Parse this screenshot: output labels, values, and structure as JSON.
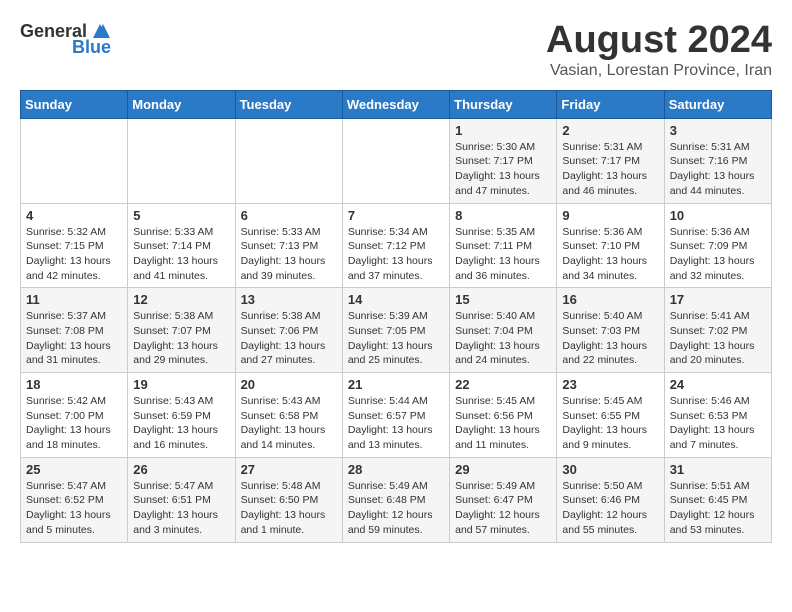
{
  "header": {
    "logo_general": "General",
    "logo_blue": "Blue",
    "main_title": "August 2024",
    "subtitle": "Vasian, Lorestan Province, Iran"
  },
  "calendar": {
    "days_of_week": [
      "Sunday",
      "Monday",
      "Tuesday",
      "Wednesday",
      "Thursday",
      "Friday",
      "Saturday"
    ],
    "weeks": [
      [
        {
          "day": "",
          "info": ""
        },
        {
          "day": "",
          "info": ""
        },
        {
          "day": "",
          "info": ""
        },
        {
          "day": "",
          "info": ""
        },
        {
          "day": "1",
          "info": "Sunrise: 5:30 AM\nSunset: 7:17 PM\nDaylight: 13 hours\nand 47 minutes."
        },
        {
          "day": "2",
          "info": "Sunrise: 5:31 AM\nSunset: 7:17 PM\nDaylight: 13 hours\nand 46 minutes."
        },
        {
          "day": "3",
          "info": "Sunrise: 5:31 AM\nSunset: 7:16 PM\nDaylight: 13 hours\nand 44 minutes."
        }
      ],
      [
        {
          "day": "4",
          "info": "Sunrise: 5:32 AM\nSunset: 7:15 PM\nDaylight: 13 hours\nand 42 minutes."
        },
        {
          "day": "5",
          "info": "Sunrise: 5:33 AM\nSunset: 7:14 PM\nDaylight: 13 hours\nand 41 minutes."
        },
        {
          "day": "6",
          "info": "Sunrise: 5:33 AM\nSunset: 7:13 PM\nDaylight: 13 hours\nand 39 minutes."
        },
        {
          "day": "7",
          "info": "Sunrise: 5:34 AM\nSunset: 7:12 PM\nDaylight: 13 hours\nand 37 minutes."
        },
        {
          "day": "8",
          "info": "Sunrise: 5:35 AM\nSunset: 7:11 PM\nDaylight: 13 hours\nand 36 minutes."
        },
        {
          "day": "9",
          "info": "Sunrise: 5:36 AM\nSunset: 7:10 PM\nDaylight: 13 hours\nand 34 minutes."
        },
        {
          "day": "10",
          "info": "Sunrise: 5:36 AM\nSunset: 7:09 PM\nDaylight: 13 hours\nand 32 minutes."
        }
      ],
      [
        {
          "day": "11",
          "info": "Sunrise: 5:37 AM\nSunset: 7:08 PM\nDaylight: 13 hours\nand 31 minutes."
        },
        {
          "day": "12",
          "info": "Sunrise: 5:38 AM\nSunset: 7:07 PM\nDaylight: 13 hours\nand 29 minutes."
        },
        {
          "day": "13",
          "info": "Sunrise: 5:38 AM\nSunset: 7:06 PM\nDaylight: 13 hours\nand 27 minutes."
        },
        {
          "day": "14",
          "info": "Sunrise: 5:39 AM\nSunset: 7:05 PM\nDaylight: 13 hours\nand 25 minutes."
        },
        {
          "day": "15",
          "info": "Sunrise: 5:40 AM\nSunset: 7:04 PM\nDaylight: 13 hours\nand 24 minutes."
        },
        {
          "day": "16",
          "info": "Sunrise: 5:40 AM\nSunset: 7:03 PM\nDaylight: 13 hours\nand 22 minutes."
        },
        {
          "day": "17",
          "info": "Sunrise: 5:41 AM\nSunset: 7:02 PM\nDaylight: 13 hours\nand 20 minutes."
        }
      ],
      [
        {
          "day": "18",
          "info": "Sunrise: 5:42 AM\nSunset: 7:00 PM\nDaylight: 13 hours\nand 18 minutes."
        },
        {
          "day": "19",
          "info": "Sunrise: 5:43 AM\nSunset: 6:59 PM\nDaylight: 13 hours\nand 16 minutes."
        },
        {
          "day": "20",
          "info": "Sunrise: 5:43 AM\nSunset: 6:58 PM\nDaylight: 13 hours\nand 14 minutes."
        },
        {
          "day": "21",
          "info": "Sunrise: 5:44 AM\nSunset: 6:57 PM\nDaylight: 13 hours\nand 13 minutes."
        },
        {
          "day": "22",
          "info": "Sunrise: 5:45 AM\nSunset: 6:56 PM\nDaylight: 13 hours\nand 11 minutes."
        },
        {
          "day": "23",
          "info": "Sunrise: 5:45 AM\nSunset: 6:55 PM\nDaylight: 13 hours\nand 9 minutes."
        },
        {
          "day": "24",
          "info": "Sunrise: 5:46 AM\nSunset: 6:53 PM\nDaylight: 13 hours\nand 7 minutes."
        }
      ],
      [
        {
          "day": "25",
          "info": "Sunrise: 5:47 AM\nSunset: 6:52 PM\nDaylight: 13 hours\nand 5 minutes."
        },
        {
          "day": "26",
          "info": "Sunrise: 5:47 AM\nSunset: 6:51 PM\nDaylight: 13 hours\nand 3 minutes."
        },
        {
          "day": "27",
          "info": "Sunrise: 5:48 AM\nSunset: 6:50 PM\nDaylight: 13 hours\nand 1 minute."
        },
        {
          "day": "28",
          "info": "Sunrise: 5:49 AM\nSunset: 6:48 PM\nDaylight: 12 hours\nand 59 minutes."
        },
        {
          "day": "29",
          "info": "Sunrise: 5:49 AM\nSunset: 6:47 PM\nDaylight: 12 hours\nand 57 minutes."
        },
        {
          "day": "30",
          "info": "Sunrise: 5:50 AM\nSunset: 6:46 PM\nDaylight: 12 hours\nand 55 minutes."
        },
        {
          "day": "31",
          "info": "Sunrise: 5:51 AM\nSunset: 6:45 PM\nDaylight: 12 hours\nand 53 minutes."
        }
      ]
    ]
  }
}
